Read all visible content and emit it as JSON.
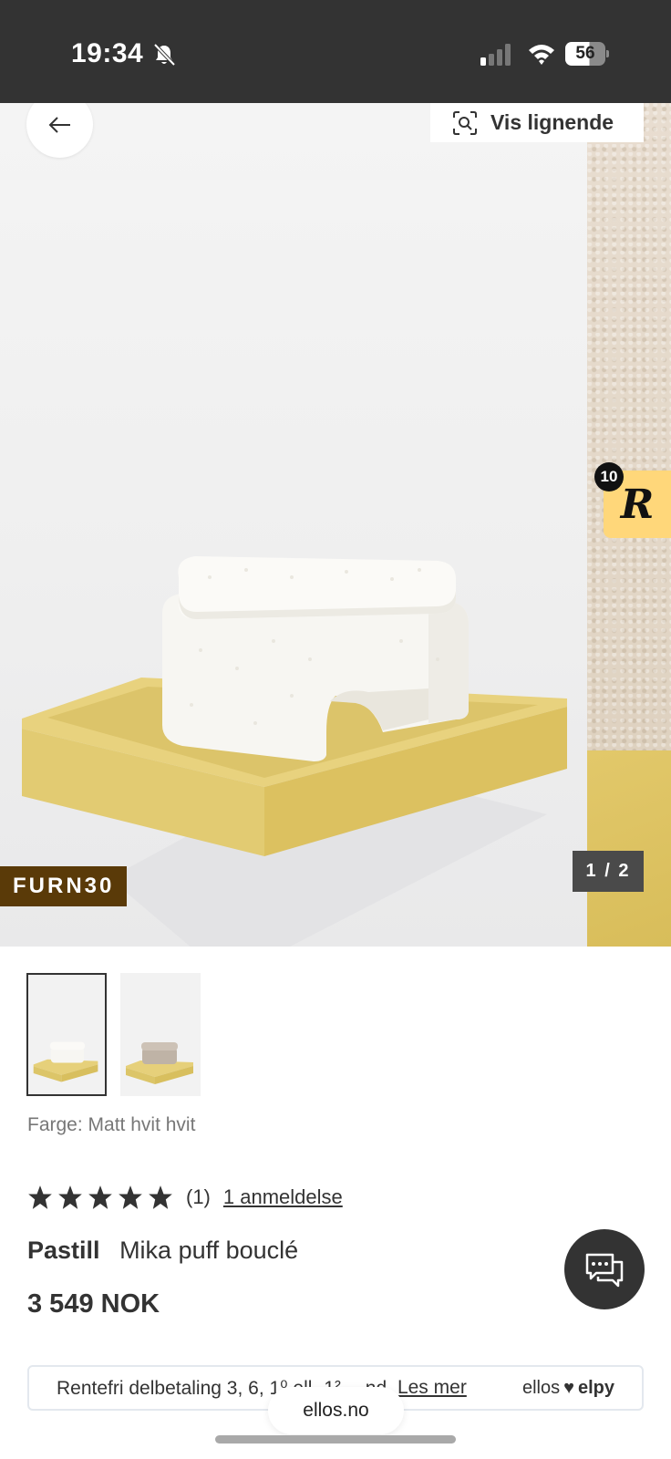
{
  "status_bar": {
    "time": "19:34",
    "battery": "56",
    "icons": [
      "bell-slash-icon",
      "cellular-signal-icon",
      "wifi-icon",
      "battery-icon"
    ]
  },
  "gallery": {
    "back_icon": "arrow-left-icon",
    "similar_icon": "visual-search-icon",
    "similar_label": "Vis lignende",
    "promo_code": "FURN30",
    "counter": "1 / 2",
    "reward_badge": {
      "count": "10",
      "letter": "R"
    },
    "thumbnails": [
      "thumbnail-white",
      "thumbnail-beige"
    ]
  },
  "product": {
    "color_label": "Farge:",
    "color_value": "Matt hvit hvit",
    "rating": {
      "stars": 5,
      "count": "(1)",
      "reviews_link": "1 anmeldelse"
    },
    "brand": "Pastill",
    "name": "Mika puff bouclé",
    "price": "3 549 NOK"
  },
  "chat": {
    "icon": "chat-icon"
  },
  "financing": {
    "text": "Rentefri delbetaling 3, 6, 1⁰ ell· 1² …nd.",
    "link": "Les mer",
    "logo_ellos": "ellos",
    "logo_elpy": "elpy"
  },
  "browser": {
    "url": "ellos.no"
  },
  "colors": {
    "dark": "#333333",
    "promo": "#5a3a08",
    "badge": "#ffd77a",
    "platform": "#e2cd78"
  }
}
